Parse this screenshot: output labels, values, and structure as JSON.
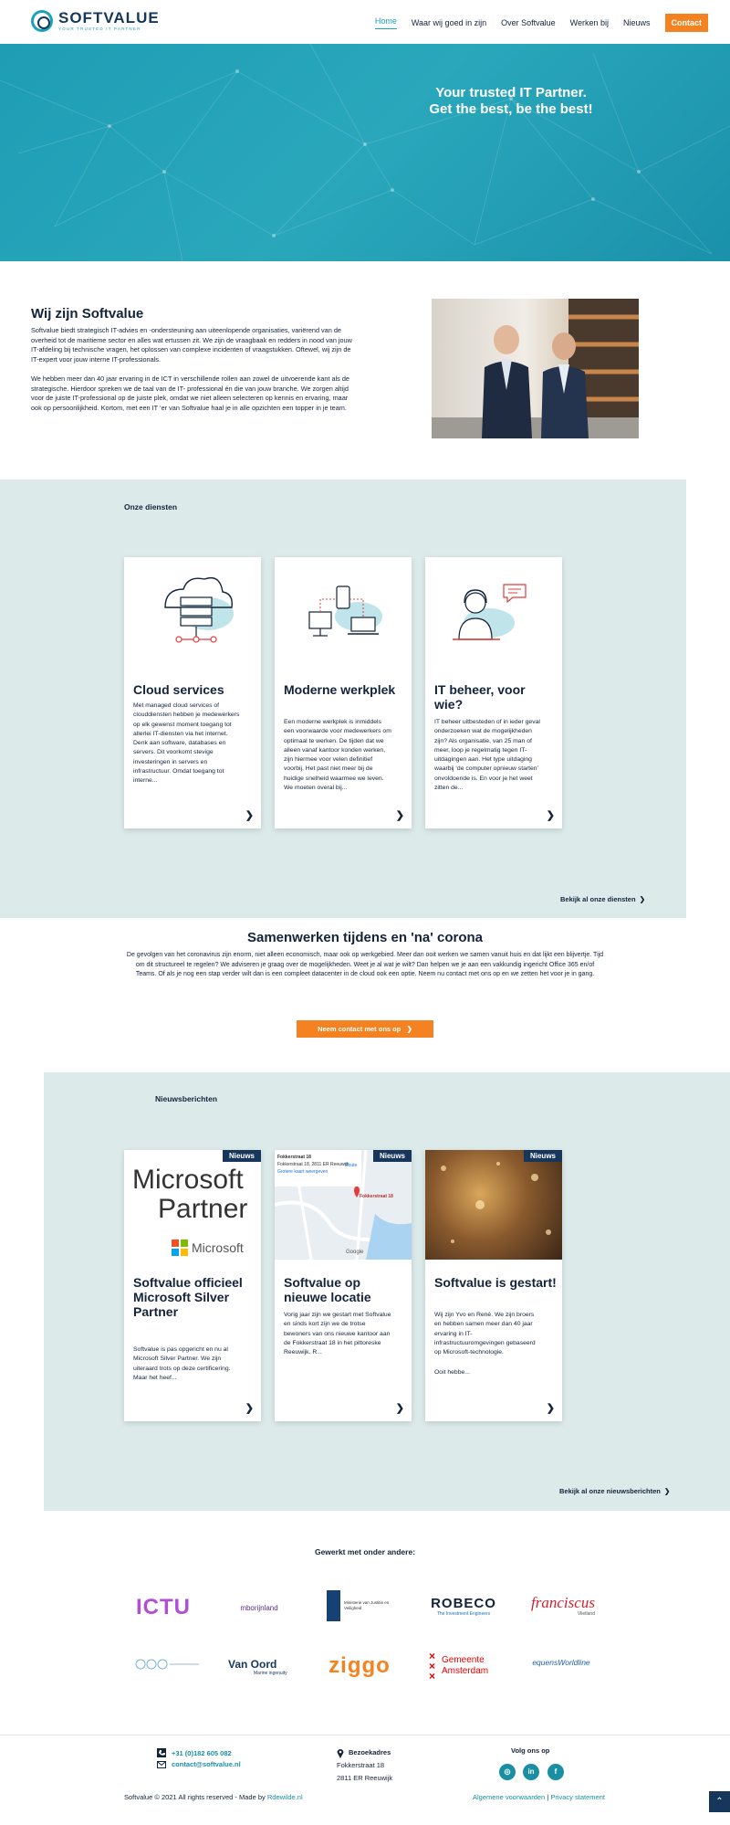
{
  "header": {
    "logo_name": "SOFTVALUE",
    "logo_tagline": "YOUR TRUSTED IT PARTNER",
    "nav": [
      "Home",
      "Waar wij goed in zijn",
      "Over Softvalue",
      "Werken bij",
      "Nieuws"
    ],
    "contact_label": "Contact"
  },
  "hero": {
    "title": "Your trusted IT Partner. Get the best, be the best!"
  },
  "about": {
    "title": "Wij zijn Softvalue",
    "p1": "Softvalue biedt strategisch IT-advies en -ondersteuning aan uiteenlopende organisaties, variërend van de overheid tot de maritieme sector en alles wat ertussen zit. We zijn de vraagbaak en redders in nood van jouw IT-afdeling bij technische vragen, het oplossen van complexe incidenten of vraagstukken. Oftewel, wij zijn de IT-expert voor jouw interne IT-professionals.",
    "p2": "We hebben meer dan 40 jaar ervaring in de ICT in verschillende rollen aan zowel de uitvoerende kant als de strategische. Hierdoor spreken we de taal van de IT- professional én die van jouw branche. We zorgen altijd voor de juiste IT-professional op de juiste plek, omdat we niet alleen selecteren op kennis en ervaring, maar ook op persoonlijkheid. Kortom, met een IT ‘er van Softvalue haal je in alle opzichten een topper in je team."
  },
  "services": {
    "label": "Onze diensten",
    "cards": [
      {
        "title": "Cloud services",
        "text": "Met managed cloud services of clouddiensten hebben je medewerkers op elk gewenst moment toegang tot allerlei IT-diensten via het internet. Denk aan software, databases en servers. Dit voorkomt stevige investeringen in servers en infrastructuur. Omdat toegang tot interne..."
      },
      {
        "title": "Moderne werkplek",
        "text": "Een moderne werkplek is inmiddels een voorwaarde voor medewerkers om optimaal te werken. De tijden dat we alleen vanaf kantoor konden werken, zijn hiermee voor velen definitief voorbij. Het past niet meer bij de huidige snelheid waarmee we leven. We moeten overal bij..."
      },
      {
        "title": "IT beheer, voor wie?",
        "text": "IT beheer uitbesteden of in ieder geval onderzoeken wat de mogelijkheden zijn? Als organisatie, van 25 man of meer, loop je regelmatig tegen IT-uitdagingen aan. Het type uitdaging waarbij ‘de computer opnieuw starten’ onvoldoende is. En voor je het weet zitten de..."
      }
    ],
    "more": "Bekijk al onze diensten"
  },
  "corona": {
    "title": "Samenwerken tijdens en 'na' corona",
    "text": "De gevolgen van het coronavirus zijn enorm, niet alleen economisch, maar ook op werkgebied. Meer dan ooit werken we samen vanuit huis en dat lijkt een blijvertje. Tijd om dit structureel te regelen? We adviseren je graag over de mogelijkheden. Weet je al wat je wilt? Dan helpen we je aan een vakkundig ingericht Office 365 en/of Teams. Of als je nog een stap verder wilt dan is een compleet datacenter in de cloud ook een optie. Neem nu contact met ons op en we zetten het voor je in gang.",
    "button": "Neem contact met ons op"
  },
  "news": {
    "label": "Nieuwsberichten",
    "badge": "Nieuws",
    "cards": [
      {
        "title": "Softvalue officieel Microsoft Silver Partner",
        "text": "Softvalue is pas opgericht en nu al Microsoft Silver Partner. We zijn uiteraard  trots op deze certificering. Maar het heef..."
      },
      {
        "title": "Softvalue op nieuwe locatie",
        "text": "Vorig jaar zijn we gestart met Softvalue en sinds kort zijn we de trotse bewoners van ons nieuwe kantoor aan de Fokkerstraat 18 in het pittoreske Reeuwijk. R..."
      },
      {
        "title": "Softvalue is gestart!",
        "text": "Wij zijn Yvo en René. We zijn broers en hebben samen meer dan 40 jaar ervaring in IT-infrastructuuromgevingen gebaseerd op Microsoft-technologie.",
        "text2": "Ooit hebbe..."
      }
    ],
    "ms_logo_line1": "Microsoft",
    "ms_logo_line2": "Partner",
    "ms_logo_brand": "Microsoft",
    "map_label": "Fokkerstraat 18",
    "map_addr": "Fokkerstraat 18, 2811 ER Reeuwijk",
    "map_route": "Route",
    "map_link": "Grotere kaart weergeven",
    "map_google": "Google",
    "more": "Bekijk al onze nieuwsberichten"
  },
  "partners": {
    "title": "Gewerkt met onder andere:",
    "logos": [
      "ICTU",
      "mborijnland",
      "Ministerie van Justitie en Veiligheid",
      "ROBECO",
      "The Investment Engineers",
      "franciscus",
      "Vlietland",
      "Van Oord",
      "Marine ingenuity",
      "ziggo",
      "Gemeente Amsterdam",
      "equensWorldline"
    ]
  },
  "footer": {
    "phone": "+31 (0)182 605 082",
    "email": "contact@softvalue.nl",
    "addr_label": "Bezoekadres",
    "addr_line1": "Fokkerstraat 18",
    "addr_line2": "2811 ER Reeuwijk",
    "follow": "Volg ons op",
    "copyright": "Softvalue © 2021 All rights reserved - Made by ",
    "made_by": "Rdewilde.nl",
    "terms": "Algemene voorwaarden",
    "separator": " | ",
    "privacy": "Privacy statement"
  },
  "colors": {
    "teal": "#1aa3b8",
    "navy": "#17365c",
    "orange": "#f58220",
    "mint": "#dcebea"
  }
}
